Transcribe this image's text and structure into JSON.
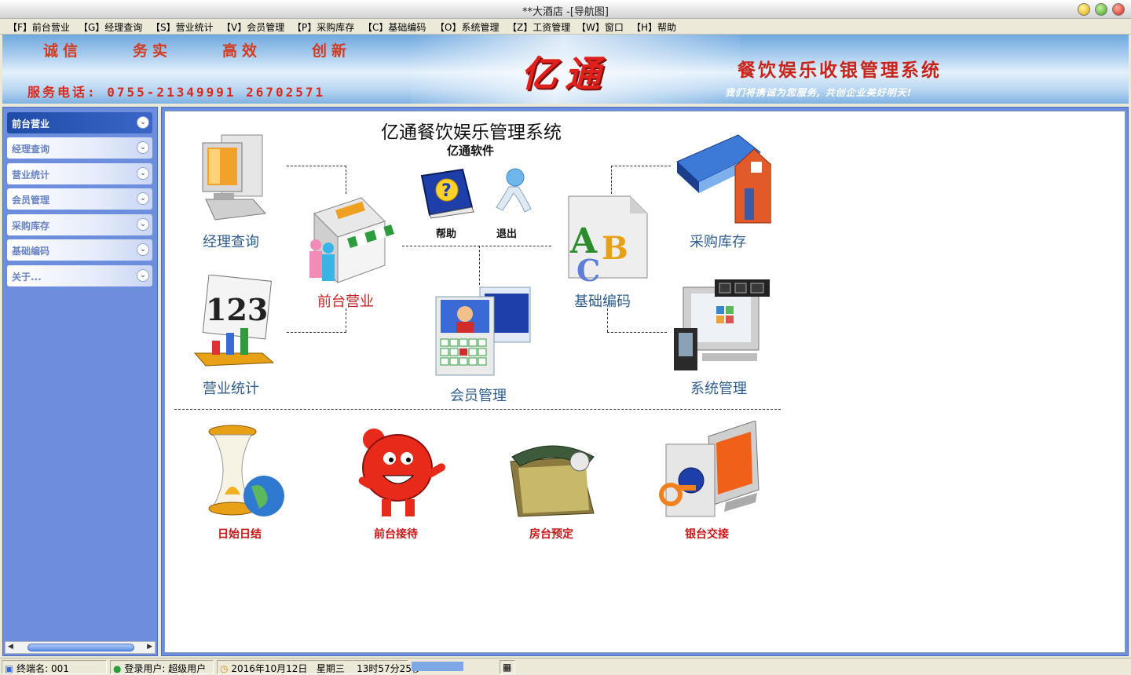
{
  "window": {
    "title": "**大酒店 -[导航图]"
  },
  "menu": [
    "【F】前台营业",
    "【G】经理查询",
    "【S】营业统计",
    "【V】会员管理",
    "【P】采购库存",
    "【C】基础编码",
    "【O】系统管理",
    "【Z】工资管理",
    "【W】窗口",
    "【H】帮助"
  ],
  "banner": {
    "slogans": [
      "诚信",
      "务实",
      "高效",
      "创新"
    ],
    "brand": "亿通",
    "system_title": "餐饮娱乐收银管理系统",
    "phone": "服务电话: 0755-21349991 26702571",
    "motto": "我们将携诚为您服务, 共创企业美好明天!"
  },
  "sidebar": {
    "items": [
      {
        "label": "前台营业",
        "active": true
      },
      {
        "label": "经理查询",
        "active": false
      },
      {
        "label": "营业统计",
        "active": false
      },
      {
        "label": "会员管理",
        "active": false
      },
      {
        "label": "采购库存",
        "active": false
      },
      {
        "label": "基础编码",
        "active": false
      },
      {
        "label": "关于...",
        "active": false
      }
    ]
  },
  "main": {
    "heading": "亿通餐饮娱乐管理系统",
    "subheading": "亿通软件",
    "modules": {
      "manager_query": "经理查询",
      "front_desk": "前台营业",
      "purchasing": "采购库存",
      "basic_codes": "基础编码",
      "stats": "营业统计",
      "members": "会员管理",
      "system": "系统管理"
    },
    "help": "帮助",
    "exit": "退出",
    "tools": {
      "day_end": "日始日结",
      "reception": "前台接待",
      "room_booking": "房台预定",
      "cashier_handover": "银台交接"
    }
  },
  "status": {
    "terminal": "终端名: 001",
    "user": "登录用户: 超级用户",
    "date": "2016年10月12日",
    "weekday": "星期三",
    "time": "13时57分25秒"
  },
  "colors": {
    "module_label": "#2e5c8f",
    "tool_label": "#c91616",
    "sidebar": "#6d8edc"
  }
}
